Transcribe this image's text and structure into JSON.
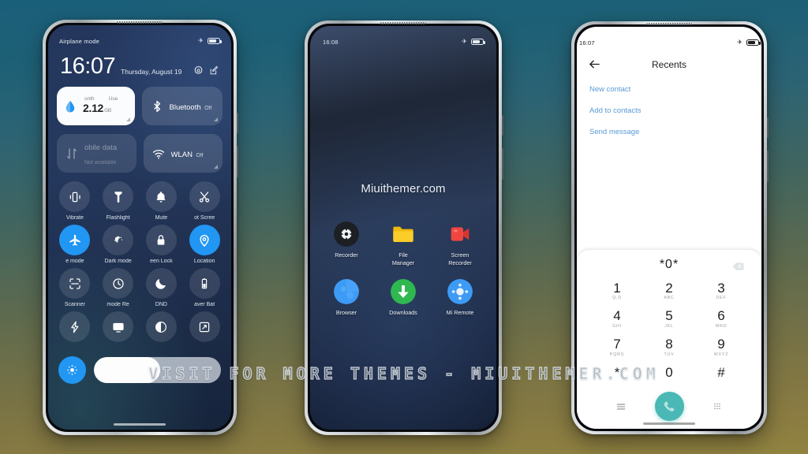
{
  "overlay": {
    "watermark": "VISIT FOR MORE THEMES - MIUITHEMER.COM"
  },
  "phone1": {
    "name": "control-center",
    "statusbar": {
      "label": "Airplane mode",
      "airplane_icon": "airplane-icon",
      "battery_icon": "battery-icon"
    },
    "clock": "16:07",
    "date": "Thursday, August 19",
    "header_icons": [
      {
        "name": "settings-gear-icon"
      },
      {
        "name": "edit-pencil-icon"
      }
    ],
    "big_tiles": [
      {
        "name": "data-usage-tile",
        "style": "light",
        "icon": "data-drop-icon",
        "col1": "onth",
        "col2": "Use",
        "value": "2.12",
        "unit": "GB"
      },
      {
        "name": "bluetooth-tile",
        "style": "glass",
        "icon": "bluetooth-icon",
        "title": "Bluetooth",
        "sub": "Off"
      },
      {
        "name": "mobile-data-tile",
        "style": "dim",
        "icon": "mobile-data-icon",
        "title": "obile data",
        "sub": "Not available"
      },
      {
        "name": "wlan-tile",
        "style": "glass",
        "icon": "wifi-icon",
        "title": "WLAN",
        "sub": "Off"
      }
    ],
    "tiles": [
      [
        {
          "name": "vibrate-tile",
          "icon": "vibrate-icon",
          "label": "Vibrate",
          "on": false
        },
        {
          "name": "flashlight-tile",
          "icon": "flashlight-icon",
          "label": "Flashlight",
          "on": false
        },
        {
          "name": "mute-tile",
          "icon": "bell-icon",
          "label": "Mute",
          "on": false
        },
        {
          "name": "screenshot-tile",
          "icon": "scissors-icon",
          "label": "ot   Scree",
          "on": false
        }
      ],
      [
        {
          "name": "airplane-mode-tile",
          "icon": "airplane-icon",
          "label": "e mode",
          "on": true
        },
        {
          "name": "dark-mode-tile",
          "icon": "dark-mode-icon",
          "label": "Dark mode",
          "on": false
        },
        {
          "name": "screen-lock-tile",
          "icon": "lock-icon",
          "label": "een   Lock",
          "on": false
        },
        {
          "name": "location-tile",
          "icon": "location-icon",
          "label": "Location",
          "on": true
        }
      ],
      [
        {
          "name": "scanner-tile",
          "icon": "scanner-icon",
          "label": "Scanner",
          "on": false
        },
        {
          "name": "reading-mode-tile",
          "icon": "reading-mode-icon",
          "label": "mode   Re",
          "on": false
        },
        {
          "name": "dnd-tile",
          "icon": "moon-icon",
          "label": "DND",
          "on": false
        },
        {
          "name": "battery-saver-tile",
          "icon": "battery-saver-icon",
          "label": "aver  Bat",
          "on": false
        }
      ],
      [
        {
          "name": "quick-ball-tile",
          "icon": "lightning-icon",
          "label": "",
          "on": false
        },
        {
          "name": "cast-tile",
          "icon": "cast-icon",
          "label": "",
          "on": false
        },
        {
          "name": "contrast-tile",
          "icon": "contrast-icon",
          "label": "",
          "on": false
        },
        {
          "name": "fullscreen-tile",
          "icon": "fullscreen-icon",
          "label": "",
          "on": false
        }
      ]
    ],
    "brightness": {
      "name": "brightness-slider",
      "icon": "brightness-icon",
      "percent": 52
    }
  },
  "phone2": {
    "name": "home-screen",
    "statusbar": {
      "time": "16:08",
      "airplane_icon": "airplane-icon",
      "battery_icon": "battery-icon"
    },
    "wallpaper_text": "Miuithemer.com",
    "apps": [
      [
        {
          "name": "app-recorder",
          "label": "Recorder",
          "icon": "recorder-icon",
          "color": "#1c1f24"
        },
        {
          "name": "app-file-manager",
          "label": "File\nManager",
          "icon": "folder-icon",
          "color": "#f5c518"
        },
        {
          "name": "app-screen-recorder",
          "label": "Screen\nRecorder",
          "icon": "screen-recorder-icon",
          "color": "#f0463f"
        }
      ],
      [
        {
          "name": "app-browser",
          "label": "Browser",
          "icon": "browser-icon",
          "color": "#3d9bf5"
        },
        {
          "name": "app-downloads",
          "label": "Downloads",
          "icon": "download-icon",
          "color": "#2eb84f"
        },
        {
          "name": "app-mi-remote",
          "label": "Mi Remote",
          "icon": "remote-icon",
          "color": "#3d9bf5"
        }
      ]
    ]
  },
  "phone3": {
    "name": "dialer-screen",
    "statusbar": {
      "time": "16:07",
      "airplane_icon": "airplane-icon",
      "battery_icon": "battery-icon"
    },
    "header": {
      "back_icon": "back-arrow-icon",
      "title": "Recents"
    },
    "options": [
      {
        "name": "new-contact-option",
        "label": "New contact"
      },
      {
        "name": "add-to-contacts-option",
        "label": "Add to contacts"
      },
      {
        "name": "send-message-option",
        "label": "Send message"
      }
    ],
    "input": {
      "value": "*0*",
      "backspace_icon": "backspace-icon"
    },
    "keypad": [
      [
        {
          "num": "1",
          "sub": "Q,D"
        },
        {
          "num": "2",
          "sub": "ABC"
        },
        {
          "num": "3",
          "sub": "DEF"
        }
      ],
      [
        {
          "num": "4",
          "sub": "GHI"
        },
        {
          "num": "5",
          "sub": "JKL"
        },
        {
          "num": "6",
          "sub": "MNO"
        }
      ],
      [
        {
          "num": "7",
          "sub": "PQRS"
        },
        {
          "num": "8",
          "sub": "TUV"
        },
        {
          "num": "9",
          "sub": "WXYZ"
        }
      ],
      [
        {
          "num": "*",
          "sub": ""
        },
        {
          "num": "0",
          "sub": ""
        },
        {
          "num": "#",
          "sub": ""
        }
      ]
    ],
    "actions": {
      "left_icon": "menu-lines-icon",
      "call_icon": "phone-call-icon",
      "right_icon": "keypad-grid-icon",
      "call_color": "#4ab8b5"
    }
  }
}
